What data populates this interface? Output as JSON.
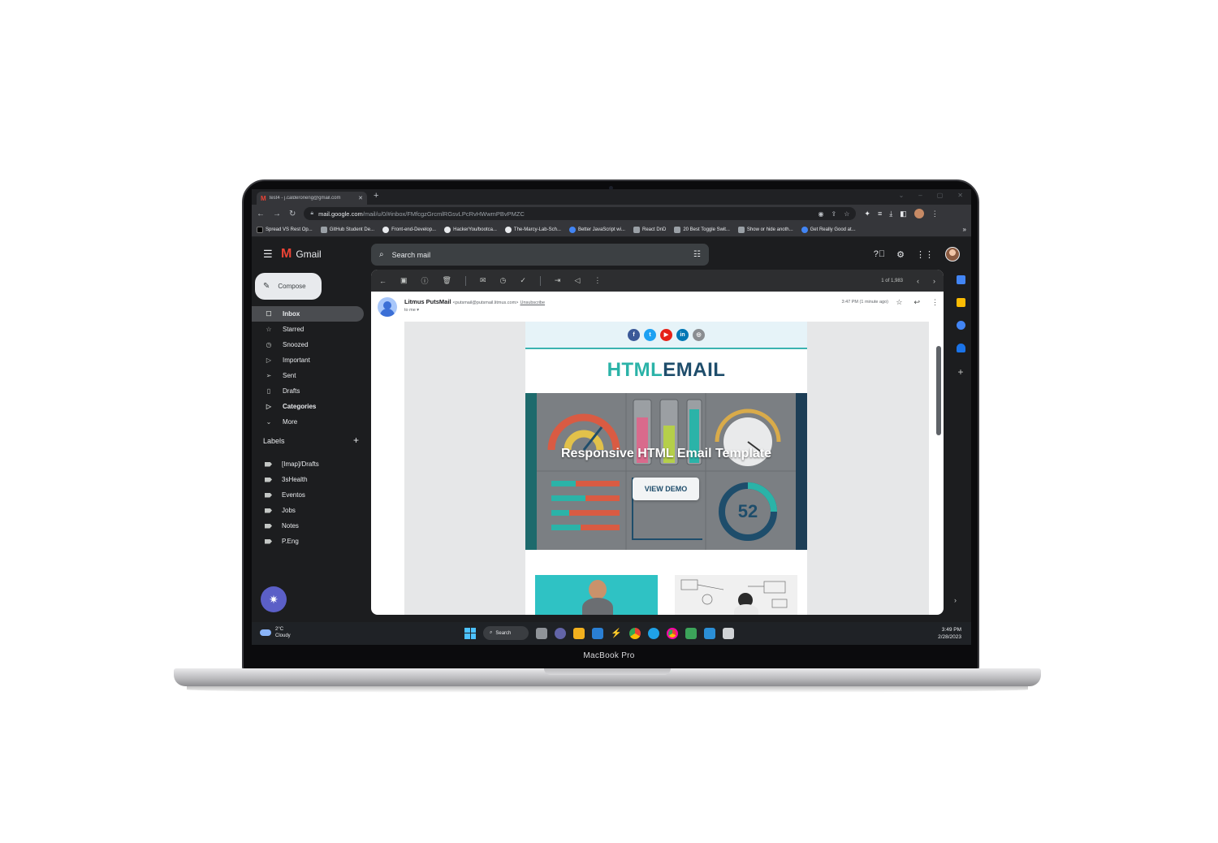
{
  "device": {
    "label": "MacBook Pro"
  },
  "browser": {
    "tab_title": "test4 - j.calderoneng@gmail.com",
    "url_host": "mail.google.com",
    "url_path": "/mail/u/0/#inbox/FMfcgzGrcmlRGsvLPcRvHWwmPBvPMZC",
    "bookmarks": [
      {
        "label": "Spread VS Rest Op...",
        "icon": "dev-icon"
      },
      {
        "label": "GitHub Student De...",
        "icon": "site-icon"
      },
      {
        "label": "Front-end-Develop...",
        "icon": "github-icon"
      },
      {
        "label": "HackerYou/bootca...",
        "icon": "github-icon"
      },
      {
        "label": "The-Marcy-Lab-Sch...",
        "icon": "github-icon"
      },
      {
        "label": "Better JavaScript wi...",
        "icon": "site-icon"
      },
      {
        "label": "React DnD",
        "icon": "site-icon"
      },
      {
        "label": "20 Best Toggle Swit...",
        "icon": "site-icon"
      },
      {
        "label": "Show or hide anoth...",
        "icon": "site-icon"
      },
      {
        "label": "Get Really Good at...",
        "icon": "site-icon"
      }
    ],
    "bookmarks_more": "»"
  },
  "gmail": {
    "app_name": "Gmail",
    "search_placeholder": "Search mail",
    "compose_label": "Compose",
    "nav": [
      {
        "label": "Inbox",
        "icon": "☐",
        "active": true
      },
      {
        "label": "Starred",
        "icon": "☆"
      },
      {
        "label": "Snoozed",
        "icon": "◷"
      },
      {
        "label": "Important",
        "icon": "▷"
      },
      {
        "label": "Sent",
        "icon": "➢"
      },
      {
        "label": "Drafts",
        "icon": "▯"
      },
      {
        "label": "Categories",
        "icon": "▷",
        "bold": true
      },
      {
        "label": "More",
        "icon": "⌄"
      }
    ],
    "labels_title": "Labels",
    "labels": [
      "[Imap]/Drafts",
      "3sHealth",
      "Eventos",
      "Jobs",
      "Notes",
      "P.Eng"
    ],
    "message": {
      "count": "1 of 1,983",
      "sender_name": "Litmus PutsMail",
      "sender_email": "<putsmail@putsmail.litmus.com>",
      "unsubscribe": "Unsubscribe",
      "to": "to me ▾",
      "time": "3:47 PM (1 minute ago)"
    },
    "email": {
      "brand_a": "HTML",
      "brand_b": "EMAIL",
      "hero_title": "Responsive HTML Email Template",
      "button": "VIEW DEMO",
      "gauge_value": "52"
    }
  },
  "taskbar": {
    "temp": "2°C",
    "condition": "Cloudy",
    "search": "Search",
    "time": "3:49 PM",
    "date": "2/28/2023"
  },
  "colors": {
    "accent_teal": "#2bb3a8",
    "accent_navy": "#1e4d6b",
    "gmail_red": "#ea4335",
    "fab": "#5b5fc7"
  }
}
